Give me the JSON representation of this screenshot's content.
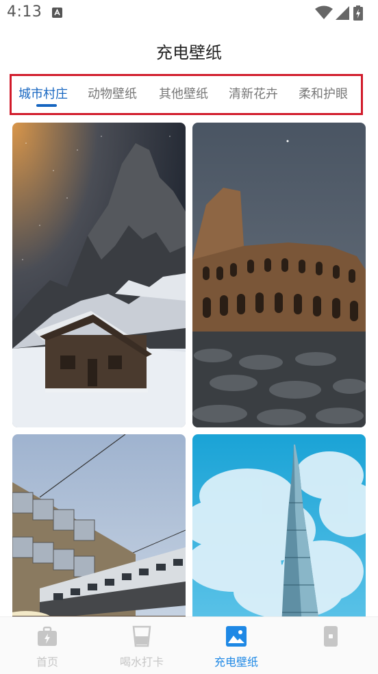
{
  "status_bar": {
    "time": "4:13",
    "icons": [
      "app-notification-icon",
      "wifi-icon",
      "signal-icon",
      "battery-charging-icon"
    ]
  },
  "header": {
    "title": "充电壁纸"
  },
  "tabs": [
    {
      "label": "城市村庄",
      "active": true
    },
    {
      "label": "动物壁纸",
      "active": false
    },
    {
      "label": "其他壁纸",
      "active": false
    },
    {
      "label": "清新花卉",
      "active": false
    },
    {
      "label": "柔和护眼",
      "active": false
    }
  ],
  "wallpapers": [
    {
      "subject": "snowy-mountain-cabin"
    },
    {
      "subject": "colosseum"
    },
    {
      "subject": "train-building"
    },
    {
      "subject": "tower-clouds"
    }
  ],
  "bottom_nav": [
    {
      "label": "首页",
      "icon": "home-bag-icon",
      "active": false
    },
    {
      "label": "喝水打卡",
      "icon": "water-cup-icon",
      "active": false
    },
    {
      "label": "充电壁纸",
      "icon": "image-icon",
      "active": true
    },
    {
      "label": "",
      "icon": "phone-icon",
      "active": false
    }
  ],
  "colors": {
    "accent": "#1565c0",
    "nav_active": "#1e88e5",
    "tab_highlight_border": "#d11a2a",
    "inactive": "#c6c6c6"
  }
}
